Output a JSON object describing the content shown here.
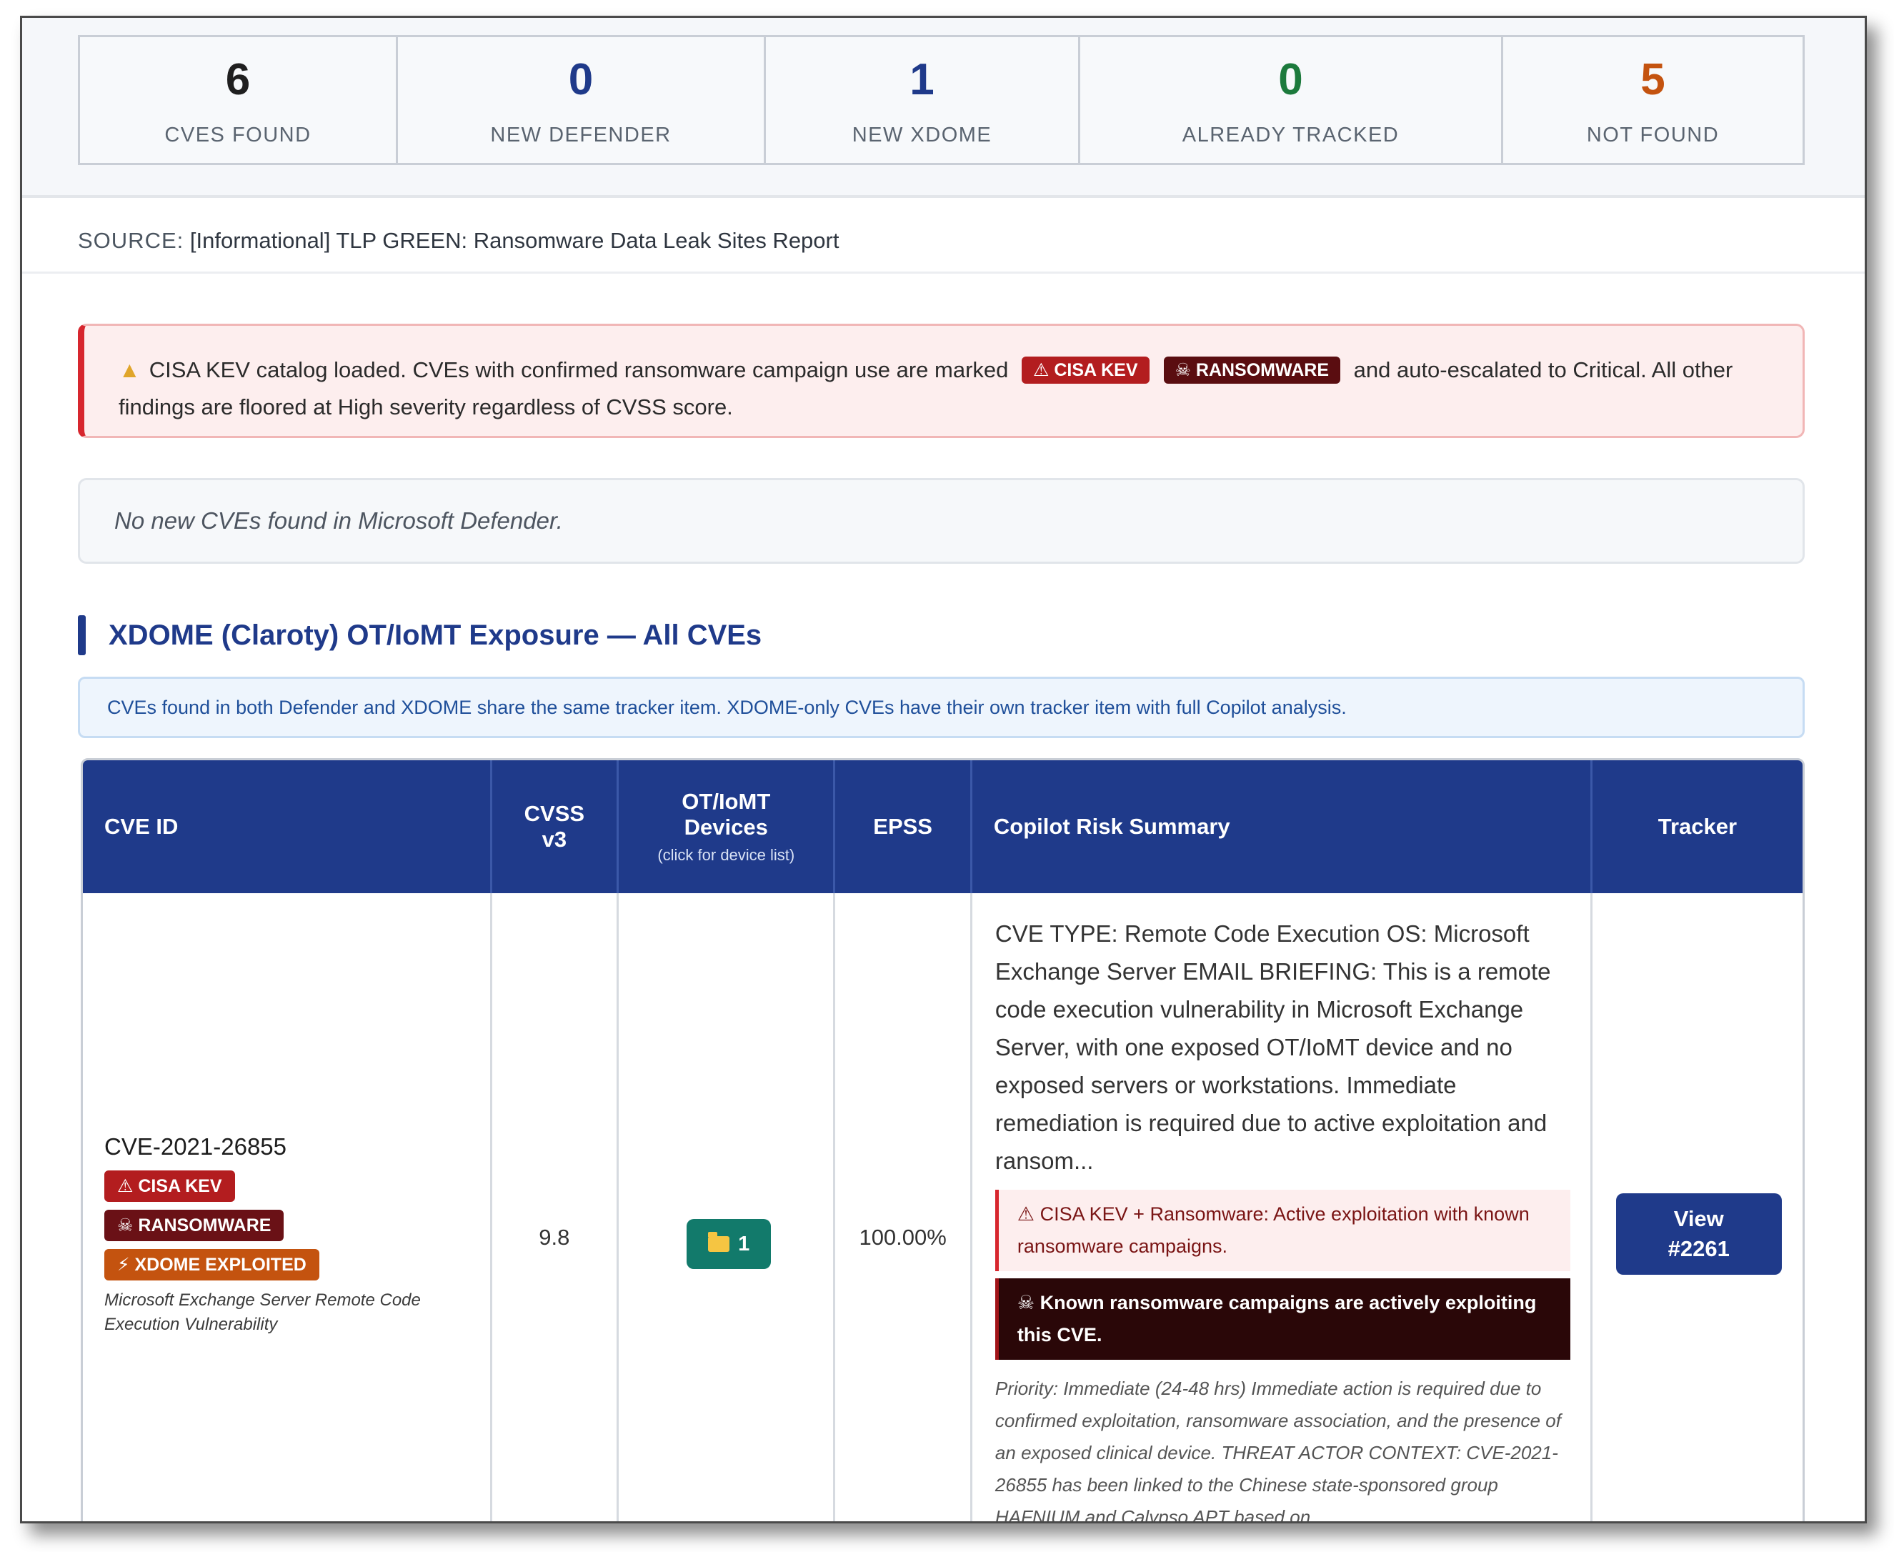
{
  "stats": [
    {
      "value": "6",
      "label": "CVES FOUND",
      "color": "#1f1f1f"
    },
    {
      "value": "0",
      "label": "NEW DEFENDER",
      "color": "#1f3a8a"
    },
    {
      "value": "1",
      "label": "NEW XDOME",
      "color": "#1f3a8a"
    },
    {
      "value": "0",
      "label": "ALREADY TRACKED",
      "color": "#1c7a3c"
    },
    {
      "value": "5",
      "label": "NOT FOUND",
      "color": "#c4530f"
    }
  ],
  "source": {
    "prefix": "SOURCE:",
    "text": "[Informational] TLP GREEN: Ransomware Data Leak Sites Report"
  },
  "alert": {
    "icon": "warning-icon",
    "text_before": "CISA KEV catalog loaded. CVEs with confirmed ransomware campaign use are marked",
    "badge_kev": "⚠ CISA KEV",
    "badge_ransomware": "☠ RANSOMWARE",
    "text_after": "and auto-escalated to Critical. All other findings are floored at High severity regardless of CVSS score."
  },
  "defender_note": "No new CVEs found in Microsoft Defender.",
  "section": {
    "title": "XDOME (Claroty) OT/IoMT Exposure — All CVEs",
    "info": "CVEs found in both Defender and XDOME share the same tracker item. XDOME-only CVEs have their own tracker item with full Copilot analysis."
  },
  "table": {
    "headers": {
      "cve_id": "CVE ID",
      "cvss_line1": "CVSS",
      "cvss_line2": "v3",
      "devices_line1": "OT/IoMT",
      "devices_line2": "Devices",
      "devices_sub": "(click for device list)",
      "epss": "EPSS",
      "summary": "Copilot Risk Summary",
      "tracker": "Tracker"
    },
    "rows": [
      {
        "cve_id": "CVE-2021-26855",
        "tags": [
          "⚠ CISA KEV",
          "☠ RANSOMWARE",
          "⚡ XDOME EXPLOITED"
        ],
        "description": "Microsoft Exchange Server Remote Code Execution Vulnerability",
        "cvss": "9.8",
        "devices": "1",
        "epss": "100.00%",
        "summary": "CVE TYPE: Remote Code Execution OS: Microsoft Exchange Server EMAIL BRIEFING: This is a remote code execution vulnerability in Microsoft Exchange Server, with one exposed OT/IoMT device and no exposed servers or workstations. Immediate remediation is required due to active exploitation and ransom...",
        "kev_note": "⚠ CISA KEV + Ransomware: Active exploitation with known ransomware campaigns.",
        "ransomware_note": "☠ Known ransomware campaigns are actively exploiting this CVE.",
        "priority": "Priority: Immediate (24-48 hrs) Immediate action is required due to confirmed exploitation, ransomware association, and the presence of an exposed clinical device. THREAT ACTOR CONTEXT: CVE-2021-26855 has been linked to the Chinese state-sponsored group HAFNIUM and Calypso APT based on",
        "tracker_line1": "View",
        "tracker_line2": "#2261"
      }
    ]
  }
}
